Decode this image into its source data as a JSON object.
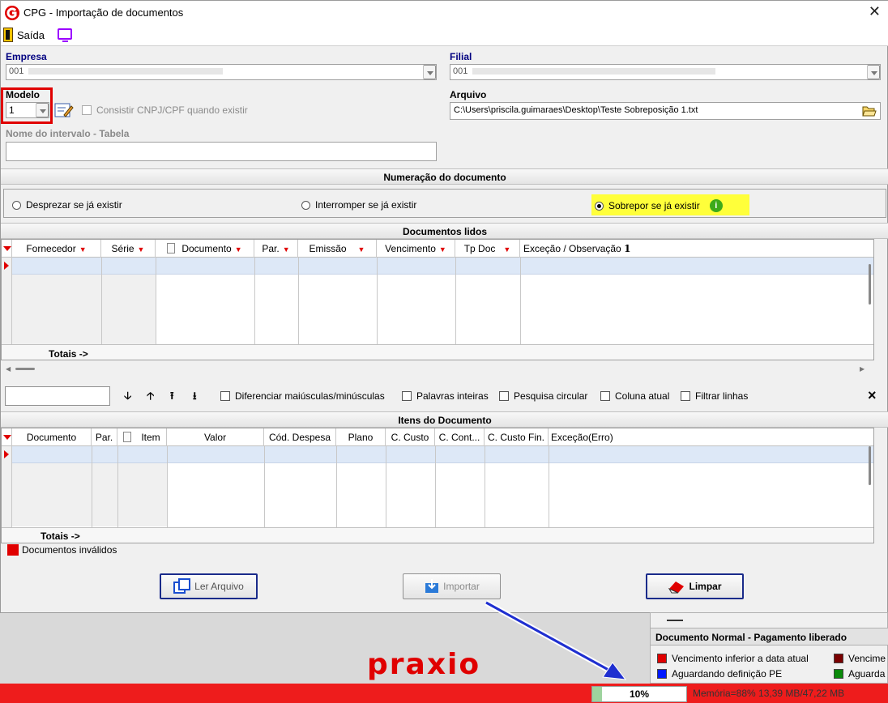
{
  "window": {
    "title": "CPG - Importação de documentos",
    "close_label": "✕"
  },
  "toolbar": {
    "exit_label": "Saída"
  },
  "form": {
    "empresa_label": "Empresa",
    "empresa_value": "001",
    "filial_label": "Filial",
    "filial_value": "001",
    "modelo_label": "Modelo",
    "modelo_value": "1",
    "consistir_label": "Consistir CNPJ/CPF quando existir",
    "arquivo_label": "Arquivo",
    "arquivo_value": "C:\\Users\\priscila.guimaraes\\Desktop\\Teste Sobreposição 1.txt",
    "nome_intervalo_label": "Nome do intervalo - Tabela",
    "nome_intervalo_value": ""
  },
  "numeracao": {
    "header": "Numeração do documento",
    "options": [
      "Desprezar se já existir",
      "Interromper se já existir",
      "Sobrepor se já existir"
    ],
    "selected": "Sobrepor se já existir"
  },
  "docs_lidos": {
    "header": "Documentos lidos",
    "columns": [
      "Fornecedor",
      "Série",
      "Documento",
      "Par.",
      "Emissão",
      "Vencimento",
      "Tp Doc",
      "Exceção / Observação"
    ],
    "sort_marker": "1",
    "totals_label": "Totais ->"
  },
  "search": {
    "options": [
      "Diferenciar maiúsculas/minúsculas",
      "Palavras inteiras",
      "Pesquisa circular",
      "Coluna atual",
      "Filtrar linhas"
    ],
    "close_label": "×"
  },
  "itens": {
    "header": "Itens do Documento",
    "columns": [
      "Documento",
      "Par.",
      "Item",
      "Valor",
      "Cód. Despesa",
      "Plano",
      "C. Custo",
      "C. Cont...",
      "C. Custo Fin.",
      "Exceção(Erro)"
    ],
    "totals_label": "Totais ->"
  },
  "legend_invalid": "Documentos inválidos",
  "buttons": {
    "ler": "Ler Arquivo",
    "importar": "Importar",
    "limpar": "Limpar"
  },
  "status_legend": {
    "header": "Documento Normal  - Pagamento liberado",
    "items": [
      {
        "label": "Vencimento inferior a data atual",
        "color": "#e00000"
      },
      {
        "label": "Vencime",
        "color": "#7a0000"
      },
      {
        "label": "Aguardando definição PE",
        "color": "#0019ff"
      },
      {
        "label": "Aguarda",
        "color": "#0a8a0a"
      }
    ]
  },
  "brand": "praxio",
  "status_bar": {
    "progress": "10%",
    "progress_value": 0.1,
    "memory": "Memória=88% 13,39 MB/47,22 MB"
  },
  "colors": {
    "accent_red": "#e00000",
    "highlight_yellow": "#ffff3a",
    "header_blue": "#000080"
  }
}
